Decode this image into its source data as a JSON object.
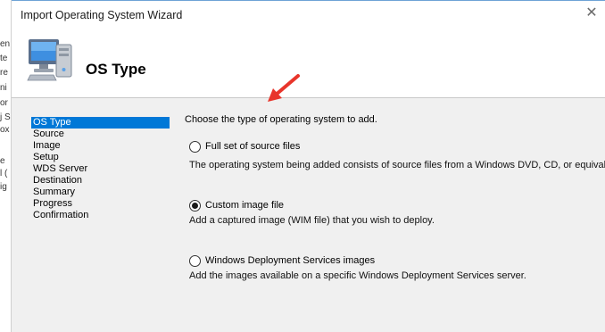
{
  "background_fragments": [
    "en",
    "te",
    "re",
    "ni",
    "or",
    "j S",
    "ox",
    "e",
    "l (",
    "ig"
  ],
  "dialog": {
    "title": "Import Operating System Wizard",
    "close_glyph": "✕"
  },
  "header": {
    "title": "OS Type",
    "icon": "computer-icon"
  },
  "nav": {
    "items": [
      "OS Type",
      "Source",
      "Image",
      "Setup",
      "WDS Server",
      "Destination",
      "Summary",
      "Progress",
      "Confirmation"
    ],
    "selected": "OS Type"
  },
  "content": {
    "prompt": "Choose the type of operating system to add.",
    "options": [
      {
        "label": "Full set of source files",
        "description": "The operating system being added consists of source files from a Windows DVD, CD, or equivalent.",
        "selected": false
      },
      {
        "label": "Custom image file",
        "description": "Add a captured image (WIM file) that you wish to deploy.",
        "selected": true
      },
      {
        "label": "Windows Deployment Services images",
        "description": "Add the images available on a specific Windows Deployment Services server.",
        "selected": false
      }
    ]
  },
  "colors": {
    "selection": "#0078d7",
    "panel": "#f0f0f0",
    "annotation_arrow": "#e8352b"
  }
}
